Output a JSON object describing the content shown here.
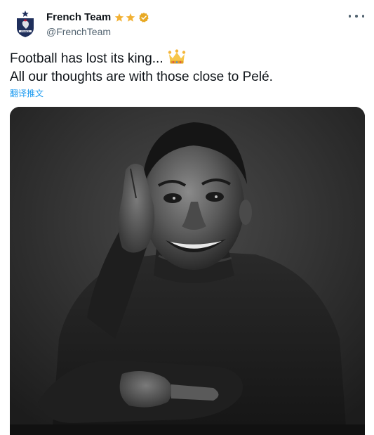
{
  "author": {
    "display_name": "French Team",
    "handle": "@FrenchTeam",
    "badge_icons": [
      "star-icon",
      "star-icon",
      "verified-badge-icon"
    ],
    "avatar_icon": "fff-crest-icon",
    "avatar_text": "FRANCE"
  },
  "tweet": {
    "line1": "Football has lost its king...",
    "line2": "All our thoughts are with those close to Pelé.",
    "emoji": "crown-icon",
    "translate_label": "翻译推文"
  },
  "media": {
    "alt": "Black and white portrait of a smiling man in a turtleneck"
  },
  "colors": {
    "accent": "#1d9bf0",
    "star": "#f2b134",
    "verified": "#e8a924",
    "text": "#0f1419",
    "secondary": "#536471",
    "crest_blue": "#1f2f5c"
  }
}
